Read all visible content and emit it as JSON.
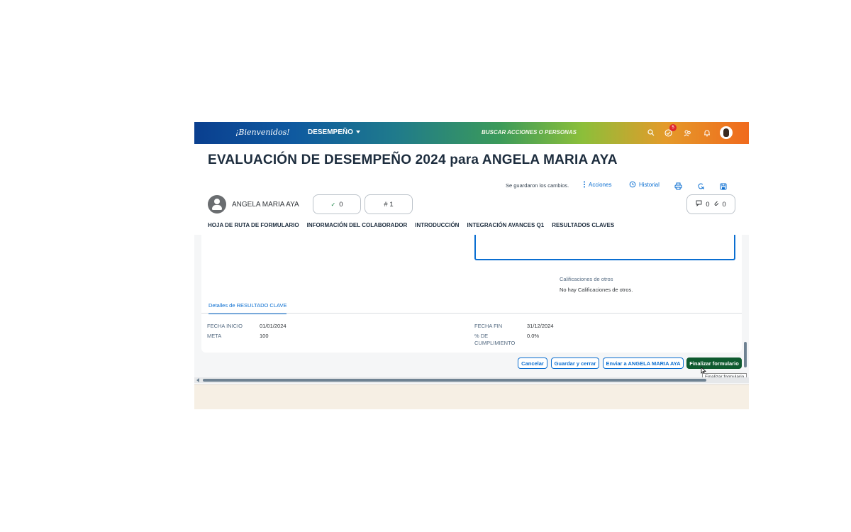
{
  "header": {
    "logo_text": "¡Bienvenidos!",
    "menu_label": "DESEMPEÑO",
    "search_placeholder": "BUSCAR ACCIONES O PERSONAS",
    "notification_count": "5"
  },
  "page": {
    "title": "EVALUACIÓN DE DESEMPEÑO 2024 para ANGELA MARIA AYA",
    "save_status": "Se guardaron los cambios.",
    "toolbar": {
      "acciones": "Acciones",
      "historial": "Historial"
    },
    "person_name": "ANGELA MARIA AYA",
    "pill_check": "0",
    "pill_hash": "# 1",
    "comments_count": "0",
    "attachments_count": "0"
  },
  "tabs": [
    "HOJA DE RUTA DE FORMULARIO",
    "INFORMACIÓN DEL COLABORADOR",
    "INTRODUCCIÓN",
    "INTEGRACIÓN AVANCES Q1",
    "RESULTADOS CLAVES"
  ],
  "ratings": {
    "label": "Calificaciones de otros",
    "empty_text": "No hay Calificaciones de otros."
  },
  "detail": {
    "subtab": "Detalles de RESULTADO CLAVE",
    "fecha_inicio_label": "FECHA INICIO",
    "fecha_inicio": "01/01/2024",
    "meta_label": "META",
    "meta": "100",
    "fecha_fin_label": "FECHA FIN",
    "fecha_fin": "31/12/2024",
    "cumplimiento_label_1": "% DE",
    "cumplimiento_label_2": "CUMPLIMIENTO",
    "cumplimiento": "0.0%"
  },
  "footer": {
    "cancel": "Cancelar",
    "save_close": "Guardar y cerrar",
    "send_to": "Enviar a ANGELA MARIA AYA",
    "finalize": "Finalizar formulario",
    "tooltip": "Finalizar formulario"
  },
  "colors": {
    "accent": "#0a6ed1",
    "primary_button": "#0e5a2f",
    "badge": "#e0262d"
  }
}
